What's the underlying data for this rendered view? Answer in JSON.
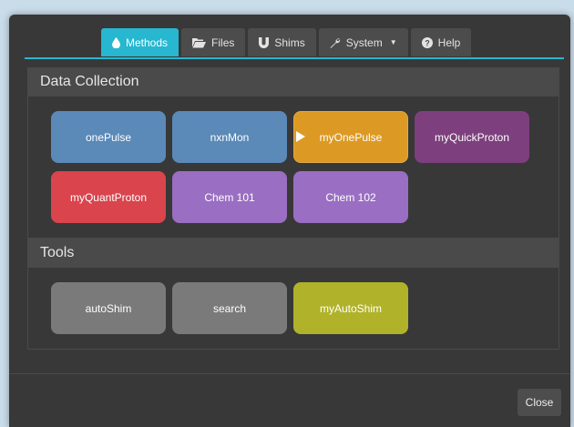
{
  "tabs": [
    {
      "label": "Methods",
      "icon": "drop-icon",
      "active": true
    },
    {
      "label": "Files",
      "icon": "folder-open-icon"
    },
    {
      "label": "Shims",
      "icon": "magnet-icon"
    },
    {
      "label": "System",
      "icon": "wrench-icon"
    },
    {
      "label": "Help",
      "icon": "question-circle-icon"
    }
  ],
  "sections": {
    "data_collection": {
      "title": "Data Collection",
      "buttons": [
        {
          "label": "onePulse",
          "color": "#5b89b8"
        },
        {
          "label": "nxnMon",
          "color": "#5b89b8"
        },
        {
          "label": "myOnePulse",
          "color": "#dc9a25",
          "selected": true
        },
        {
          "label": "myQuickProton",
          "color": "#7d3f7d"
        },
        {
          "label": "myQuantProton",
          "color": "#d9444d"
        },
        {
          "label": "Chem 101",
          "color": "#9a6ec2"
        },
        {
          "label": "Chem 102",
          "color": "#9a6ec2"
        }
      ]
    },
    "tools": {
      "title": "Tools",
      "buttons": [
        {
          "label": "autoShim",
          "color": "#7a7a7a"
        },
        {
          "label": "search",
          "color": "#7a7a7a"
        },
        {
          "label": "myAutoShim",
          "color": "#b0b22a"
        }
      ]
    }
  },
  "footer": {
    "close_label": "Close"
  },
  "colors": {
    "accent": "#27b7d0",
    "panel": "#383838",
    "backdrop": "#c9dcea"
  }
}
